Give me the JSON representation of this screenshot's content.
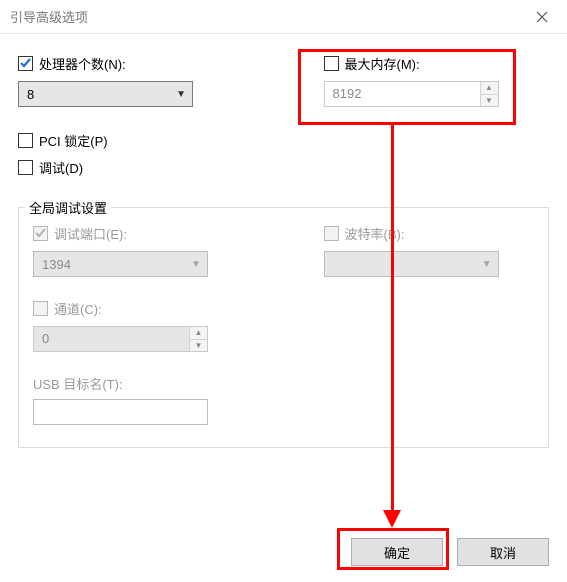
{
  "titlebar": {
    "title": "引导高级选项"
  },
  "proc": {
    "label": "处理器个数(N):",
    "checked": true,
    "value": "8"
  },
  "maxmem": {
    "label": "最大内存(M):",
    "checked": false,
    "value": "8192"
  },
  "pci_lock": {
    "label": "PCI 锁定(P)",
    "checked": false
  },
  "debug": {
    "label": "调试(D)",
    "checked": false
  },
  "global_debug": {
    "legend": "全局调试设置",
    "port": {
      "label": "调试端口(E):",
      "value": "1394",
      "enabled": false
    },
    "baud": {
      "label": "波特率(B):",
      "value": "",
      "enabled": false
    },
    "channel": {
      "label": "通道(C):",
      "value": "0",
      "enabled": false
    },
    "usb_target": {
      "label": "USB 目标名(T):",
      "value": "",
      "enabled": false
    }
  },
  "buttons": {
    "ok": "确定",
    "cancel": "取消"
  },
  "colors": {
    "annotation": "#ff0000"
  }
}
